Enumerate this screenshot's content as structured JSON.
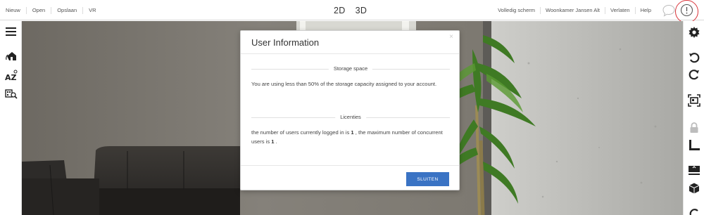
{
  "menu": {
    "new": "Nieuw",
    "open": "Open",
    "save": "Opslaan",
    "vr": "VR"
  },
  "view": {
    "mode_2d": "2D",
    "mode_3d": "3D"
  },
  "header_right": {
    "fullscreen": "Volledig scherm",
    "project_name": "Woonkamer Jansen Alt",
    "leave": "Verlaten",
    "help": "Help"
  },
  "modal": {
    "title": "User Information",
    "close_glyph": "×",
    "storage": {
      "heading": "Storage space",
      "text": "You are using less than 50% of the storage capacity assigned to your account."
    },
    "licenses": {
      "heading": "Licenties",
      "text_before": "the number of users currently logged in is ",
      "logged_in_count": "1",
      "text_middle": " , the maximum number of concurrent users is ",
      "max_users": "1",
      "text_after": " ."
    },
    "button_label": "SLUITEN"
  },
  "colors": {
    "accent_blue": "#3a73c4",
    "highlight_ring": "#d9343a"
  },
  "icons": {
    "left": [
      "hamburger-menu-icon",
      "house-rotate-icon",
      "sort-az-icon",
      "search-building-icon"
    ],
    "right": [
      "settings-icon",
      "undo-icon",
      "redo-icon",
      "screen-capture-icon",
      "lock-icon",
      "ruler-icon",
      "floor-level-icon",
      "3d-box-icon"
    ],
    "top": [
      "chat-icon",
      "info-icon"
    ]
  }
}
